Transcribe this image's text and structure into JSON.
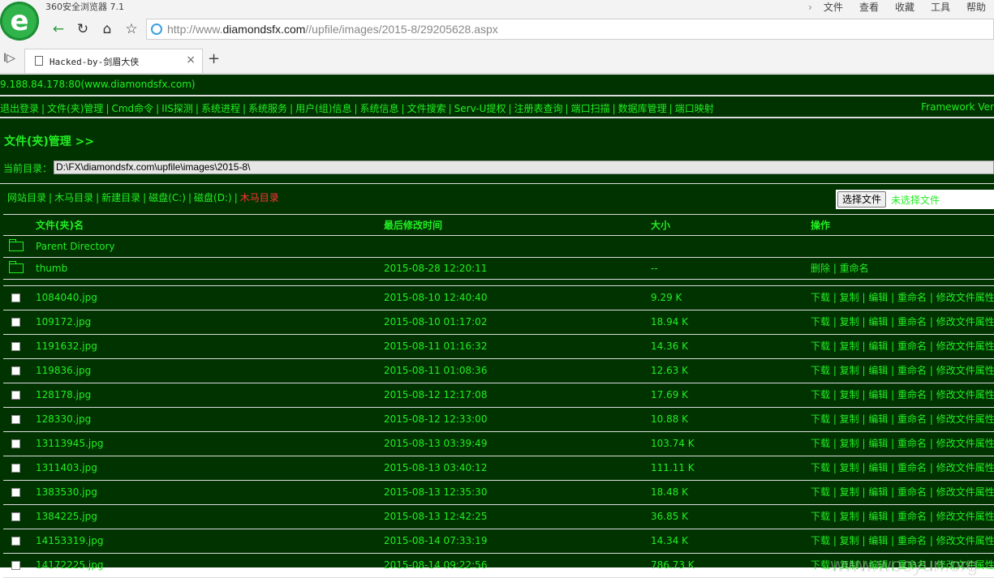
{
  "browser": {
    "app_title": "360安全浏览器 7.1",
    "logo_letter": "e",
    "menu": [
      "文件",
      "查看",
      "收藏",
      "工具",
      "帮助"
    ],
    "url_prefix": "http://www.",
    "url_domain": "diamondsfx.com",
    "url_path": "//upfile/images/2015-8/29205628.aspx",
    "tab_title": "Hacked-by-剑眉大侠",
    "tab_close": "×",
    "new_tab": "+"
  },
  "header": {
    "server": "9.188.84.178:80(www.diamondsfx.com)",
    "nav": [
      "退出登录",
      "文件(夹)管理",
      "Cmd命令",
      "IIS探测",
      "系统进程",
      "系统服务",
      "用户(组)信息",
      "系统信息",
      "文件搜索",
      "Serv-U提权",
      "注册表查询",
      "端口扫描",
      "数据库管理",
      "端口映射"
    ],
    "framework": "Framework Ver"
  },
  "section_title": "文件(夹)管理 >>",
  "current_dir": {
    "label": "当前目录：",
    "value": "D:\\FX\\diamondsfx.com\\upfile\\images\\2015-8\\"
  },
  "quick_links": [
    "网站目录",
    "木马目录",
    "新建目录",
    "磁盘(C:)",
    "磁盘(D:)"
  ],
  "quick_link_active": "木马目录",
  "upload": {
    "button": "选择文件",
    "status": "未选择文件"
  },
  "table": {
    "columns": [
      "文件(夹)名",
      "最后修改时间",
      "大小",
      "操作"
    ],
    "dirs": [
      {
        "name": "Parent Directory",
        "time": "",
        "size": "",
        "actions": ""
      },
      {
        "name": "thumb",
        "time": "2015-08-28 12:20:11",
        "size": "--",
        "actions": "删除 | 重命名"
      }
    ],
    "file_actions": "下载 | 复制 | 编辑 | 重命名 | 修改文件属性",
    "files": [
      {
        "name": "1084040.jpg",
        "time": "2015-08-10 12:40:40",
        "size": "9.29 K"
      },
      {
        "name": "109172.jpg",
        "time": "2015-08-10 01:17:02",
        "size": "18.94 K"
      },
      {
        "name": "1191632.jpg",
        "time": "2015-08-11 01:16:32",
        "size": "14.36 K"
      },
      {
        "name": "119836.jpg",
        "time": "2015-08-11 01:08:36",
        "size": "12.63 K"
      },
      {
        "name": "128178.jpg",
        "time": "2015-08-12 12:17:08",
        "size": "17.69 K"
      },
      {
        "name": "128330.jpg",
        "time": "2015-08-12 12:33:00",
        "size": "10.88 K"
      },
      {
        "name": "13113945.jpg",
        "time": "2015-08-13 03:39:49",
        "size": "103.74 K"
      },
      {
        "name": "1311403.jpg",
        "time": "2015-08-13 03:40:12",
        "size": "111.11 K"
      },
      {
        "name": "1383530.jpg",
        "time": "2015-08-13 12:35:30",
        "size": "18.48 K"
      },
      {
        "name": "1384225.jpg",
        "time": "2015-08-13 12:42:25",
        "size": "36.85 K"
      },
      {
        "name": "14153319.jpg",
        "time": "2015-08-14 07:33:19",
        "size": "14.34 K"
      },
      {
        "name": "14172225.jpg",
        "time": "2015-08-14 09:22:56",
        "size": "786.73 K"
      }
    ]
  },
  "watermark": "www.wooyun.org"
}
